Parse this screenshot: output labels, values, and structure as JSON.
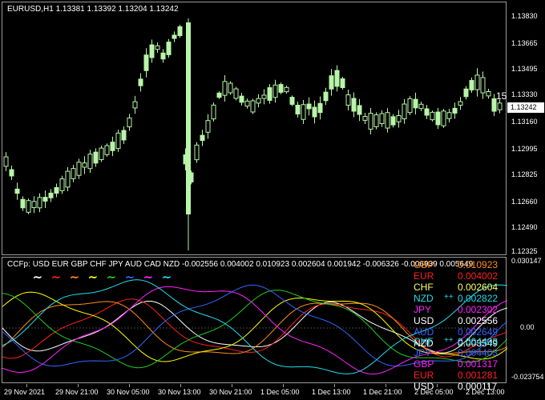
{
  "main_chart": {
    "symbol": "EURUSD,H1",
    "ohlc": "1.13381 1.13392 1.13204 1.13242",
    "current_price": "1.13242",
    "price_labels": [
      "1.13830",
      "1.13665",
      "1.13495",
      "1.13330",
      "1.13160",
      "1.12995",
      "1.12825",
      "1.12660",
      "1.12490",
      "1.12325"
    ],
    "marker": "15",
    "candle_color": "#b8f5a8"
  },
  "indicator": {
    "name": "CCFp:",
    "currencies": "USD EUR GBP CHF JPY AUD CAD NZD",
    "values": "-0.002556 0.004002 0.010923 0.002604 0.001942 -0.006326 -0.006939 0.005649",
    "axis_labels": [
      "0.030147",
      "0.00",
      "-0.023754"
    ],
    "wave_colors": [
      "#ffffff",
      "#ff2020",
      "#ff8c1a",
      "#ffff00",
      "#22cc22",
      "#3366ff",
      "#ff22ff",
      "#22ddee"
    ],
    "top_list": [
      {
        "name": "GBP",
        "arrow": "",
        "value": "0.010923",
        "color": "#ff8c1a"
      },
      {
        "name": "EUR",
        "arrow": "",
        "value": "0.004002",
        "color": "#ff2020"
      },
      {
        "name": "CHF",
        "arrow": "",
        "value": "0.002604",
        "color": "#ffff66"
      },
      {
        "name": "NZD",
        "arrow": "++",
        "value": "0.002822",
        "color": "#22ddee"
      },
      {
        "name": "JPY",
        "arrow": "",
        "value": "0.002302",
        "color": "#ff22ff"
      },
      {
        "name": "USD",
        "arrow": "",
        "value": "0.002556",
        "color": "#ffffff"
      },
      {
        "name": "AUD",
        "arrow": "",
        "value": "0.002649",
        "color": "#3366ff"
      },
      {
        "name": "NZD",
        "arrow": "",
        "value": "0.003549",
        "color": "#ffffff"
      }
    ],
    "bottom_list": [
      {
        "name": "CHF",
        "arrow": "++",
        "value": "0.004403",
        "color": "#22ddee"
      },
      {
        "name": "JPY",
        "arrow": "",
        "value": "0.004403",
        "color": "#3366ff"
      },
      {
        "name": "GBP",
        "arrow": "",
        "value": "0.001317",
        "color": "#ff22ff"
      },
      {
        "name": "EUR",
        "arrow": "",
        "value": "0.001281",
        "color": "#ff2020"
      },
      {
        "name": "USD",
        "arrow": "",
        "value": "0.000117",
        "color": "#ffffff"
      }
    ]
  },
  "time_axis": [
    "29 Nov 2021",
    "29 Nov 21:00",
    "30 Nov 05:00",
    "30 Nov 13:00",
    "30 Nov 21:00",
    "1 Dec 05:00",
    "1 Dec 13:00",
    "1 Dec 21:00",
    "2 Dec 05:00",
    "2 Dec 13:00"
  ]
}
